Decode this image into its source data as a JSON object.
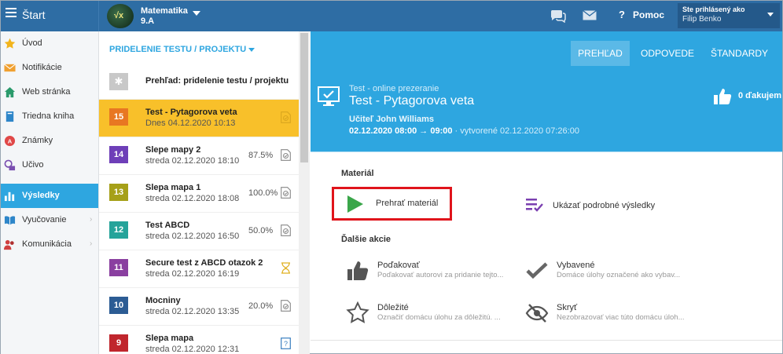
{
  "topbar": {
    "start_label": "Štart",
    "subject": "Matematika",
    "class_name": "9.A",
    "help_label": "Pomoc",
    "help_glyph": "?",
    "logged_in_label": "Ste prihlásený ako",
    "user_name": "Filip Benko"
  },
  "sidebar": {
    "items": [
      {
        "label": "Úvod",
        "icon": "star-icon"
      },
      {
        "label": "Notifikácie",
        "icon": "envelope-icon"
      },
      {
        "label": "Web stránka",
        "icon": "home-icon"
      },
      {
        "label": "Triedna kniha",
        "icon": "book-icon"
      },
      {
        "label": "Známky",
        "icon": "grade-icon"
      },
      {
        "label": "Učivo",
        "icon": "lesson-icon"
      },
      {
        "label": "Výsledky",
        "icon": "bar-chart-icon",
        "active": true
      },
      {
        "label": "Vyučovanie",
        "icon": "open-book-icon",
        "chevron": "›"
      },
      {
        "label": "Komunikácia",
        "icon": "people-icon",
        "chevron": "›"
      }
    ]
  },
  "middle": {
    "heading": "PRIDELENIE TESTU / PROJEKTU",
    "overview_title": "Prehľad: pridelenie testu / projektu",
    "items": [
      {
        "num": "15",
        "title": "Test - Pytagorova veta",
        "date": "Dnes 04.12.2020 10:13",
        "pct": "",
        "color": "#e87722",
        "active": true,
        "icon": "check-doc-icon"
      },
      {
        "num": "14",
        "title": "Slepe mapy 2",
        "date": "streda 02.12.2020 18:10",
        "pct": "87.5%",
        "color": "#6e3fb8",
        "icon": "check-doc-icon"
      },
      {
        "num": "13",
        "title": "Slepa mapa 1",
        "date": "streda 02.12.2020 18:08",
        "pct": "100.0%",
        "color": "#a6a018",
        "icon": "check-doc-icon"
      },
      {
        "num": "12",
        "title": "Test ABCD",
        "date": "streda 02.12.2020 16:50",
        "pct": "50.0%",
        "color": "#25a39a",
        "icon": "check-doc-icon"
      },
      {
        "num": "11",
        "title": "Secure test z ABCD otazok 2",
        "date": "streda 02.12.2020 16:19",
        "pct": "",
        "color": "#8a3fa0",
        "icon": "hourglass-icon"
      },
      {
        "num": "10",
        "title": "Mocniny",
        "date": "streda 02.12.2020 13:35",
        "pct": "20.0%",
        "color": "#2c5c94",
        "icon": "check-doc-icon"
      },
      {
        "num": "9",
        "title": "Slepa mapa",
        "date": "streda 02.12.2020 12:31",
        "pct": "",
        "color": "#c0262d",
        "icon": "question-doc-icon"
      }
    ]
  },
  "tabs": [
    {
      "label": "PREHĽAD",
      "active": true
    },
    {
      "label": "ODPOVEDE"
    },
    {
      "label": "ŠTANDARDY"
    }
  ],
  "hero": {
    "subtitle": "Test - online prezeranie",
    "title": "Test - Pytagorova veta",
    "teacher": "Učiteľ John Williams",
    "dates": "02.12.2020 08:00 → 09:00",
    "created": " · vytvorené 02.12.2020 07:26:00",
    "thanks": "0 ďakujem"
  },
  "content": {
    "material_label": "Materiál",
    "play_label": "Prehrať materiál",
    "detail_label": "Ukázať podrobné výsledky",
    "more_label": "Ďalšie akcie",
    "actions": [
      {
        "title": "Poďakovať",
        "desc": "Poďakovať autorovi za pridanie tejto...",
        "icon": "thumbs-up-icon"
      },
      {
        "title": "Vybavené",
        "desc": "Domáce úlohy označené ako vybav...",
        "icon": "checkmark-icon"
      },
      {
        "title": "Dôležité",
        "desc": "Označiť domácu úlohu za dôležitú. ...",
        "icon": "star-outline-icon"
      },
      {
        "title": "Skryť",
        "desc": "Nezobrazovať viac túto domácu úloh...",
        "icon": "eye-slash-icon"
      }
    ]
  },
  "colors": {
    "topbar": "#2e6da4",
    "accent": "#2ea6e0",
    "active_row": "#f8c02a",
    "highlight_box": "#e0141b",
    "play": "#3aa64a"
  }
}
